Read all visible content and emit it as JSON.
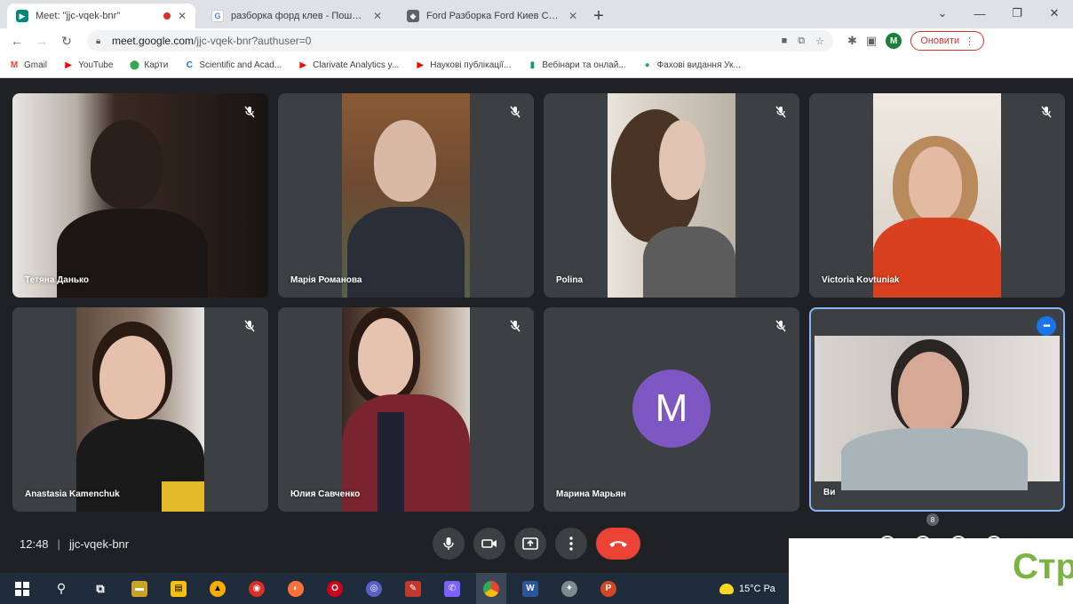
{
  "browser": {
    "tabs": [
      {
        "title": "Meet: \"jjc-vqek-bnr\"",
        "active": true,
        "recording": true
      },
      {
        "title": "разборка форд клев - Пошук Google",
        "active": false
      },
      {
        "title": "Ford Разборка Ford Киев Софі...",
        "active": false
      }
    ],
    "window_controls": [
      "⌄",
      "—",
      "❐",
      "✕"
    ],
    "url_host": "meet.google.com",
    "url_path": "/jjc-vqek-bnr?authuser=0",
    "profile_initial": "M",
    "update_label": "Оновити",
    "bookmarks": [
      {
        "label": "Gmail",
        "icon": "gmail-icon",
        "color": "#ea4335"
      },
      {
        "label": "YouTube",
        "icon": "youtube-icon",
        "color": "#ff0000"
      },
      {
        "label": "Карти",
        "icon": "maps-icon",
        "color": "#34a853"
      },
      {
        "label": "Scientific and Acad...",
        "icon": "clarivate-icon",
        "color": "#1a73e8"
      },
      {
        "label": "Clarivate Analytics y...",
        "icon": "youtube-icon",
        "color": "#ff0000"
      },
      {
        "label": "Наукові публікації...",
        "icon": "youtube-icon",
        "color": "#ff0000"
      },
      {
        "label": "Вебінари та онлай...",
        "icon": "webinar-icon",
        "color": "#0f9d58"
      },
      {
        "label": "Фахові видання Ук...",
        "icon": "journals-icon",
        "color": "#34a853"
      }
    ]
  },
  "meet": {
    "participants": [
      {
        "name": "Тетяна Данько"
      },
      {
        "name": "Марія Романова"
      },
      {
        "name": "Polina"
      },
      {
        "name": "Victoria Kovtuniak"
      },
      {
        "name": "Anastasia Kamenchuk"
      },
      {
        "name": "Юлия Савченко"
      },
      {
        "name": "Марина Марьян",
        "avatar": "M"
      },
      {
        "name": "Ви",
        "self": true
      }
    ],
    "time": "12:48",
    "meeting_code": "jjc-vqek-bnr",
    "participant_count": "8"
  },
  "overlay": {
    "text": "Стр"
  },
  "taskbar": {
    "weather_text": "15°C  Ра"
  },
  "colors": {
    "meet_bg": "#202124",
    "tile_bg": "#3c4043",
    "end_call": "#ea4335",
    "avatar": "#7e57c2",
    "self_border": "#8ab4f8",
    "overlay_text": "#7cb342"
  }
}
